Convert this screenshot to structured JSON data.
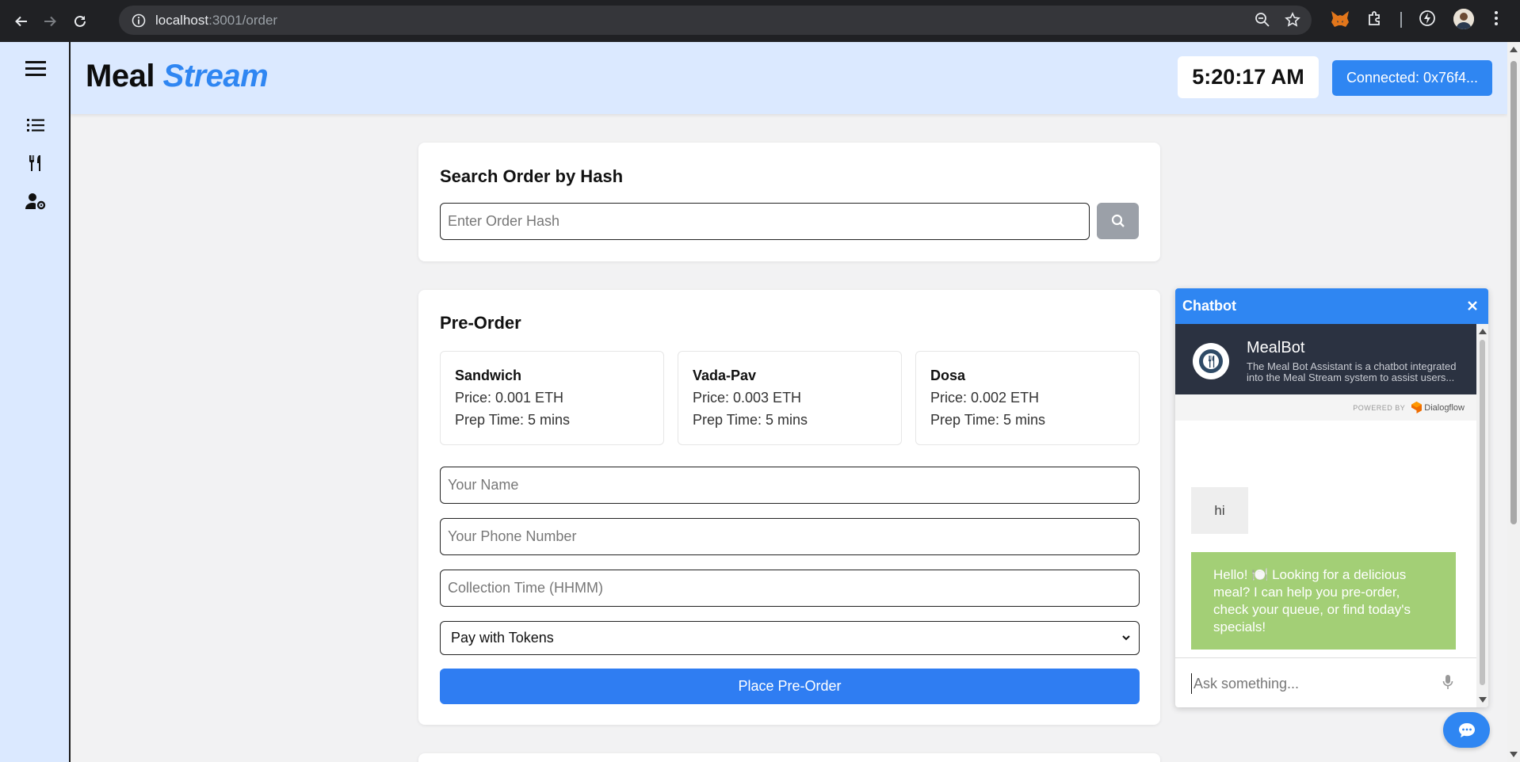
{
  "browser": {
    "url_host": "localhost",
    "url_path": ":3001/order",
    "icons": [
      "back-icon",
      "forward-icon",
      "reload-icon",
      "info-icon",
      "zoom-icon",
      "star-icon",
      "metamask-icon",
      "extensions-icon",
      "bolt-icon",
      "profile-avatar",
      "more-icon"
    ]
  },
  "sidebar": {
    "items": [
      {
        "icon": "menu-icon"
      },
      {
        "icon": "list-icon"
      },
      {
        "icon": "utensils-icon"
      },
      {
        "icon": "user-settings-icon"
      }
    ]
  },
  "header": {
    "logo_part1": "Meal",
    "logo_part2": "Stream",
    "clock": "5:20:17 AM",
    "connect_label": "Connected: 0x76f4..."
  },
  "search": {
    "title": "Search Order by Hash",
    "placeholder": "Enter Order Hash",
    "icon": "search-icon"
  },
  "preorder": {
    "title": "Pre-Order",
    "menu": [
      {
        "name": "Sandwich",
        "price": "Price: 0.001 ETH",
        "prep": "Prep Time: 5 mins"
      },
      {
        "name": "Vada-Pav",
        "price": "Price: 0.003 ETH",
        "prep": "Prep Time: 5 mins"
      },
      {
        "name": "Dosa",
        "price": "Price: 0.002 ETH",
        "prep": "Prep Time: 5 mins"
      }
    ],
    "name_placeholder": "Your Name",
    "phone_placeholder": "Your Phone Number",
    "time_placeholder": "Collection Time (HHMM)",
    "payment_selected": "Pay with Tokens",
    "submit_label": "Place Pre-Order"
  },
  "chatbot": {
    "title": "Chatbot",
    "bot_name": "MealBot",
    "bot_description": "The Meal Bot Assistant is a chatbot integrated into the Meal Stream system to assist users...",
    "powered_by": "POWERED BY",
    "powered_name": "Dialogflow",
    "messages": [
      {
        "from": "user",
        "text": "hi"
      },
      {
        "from": "bot",
        "text": "Hello! 🍽️ Looking for a delicious meal? I can help you pre-order, check your queue, or find today's specials!"
      }
    ],
    "input_placeholder": "Ask something...",
    "colors": {
      "header": "#2f86f2",
      "bot_bubble": "#a3cf76",
      "info_bar": "#2b3241"
    }
  },
  "colors": {
    "accent": "#2f86f2",
    "header_bg": "#dbe9ff",
    "page_bg": "#f2f2f3"
  }
}
